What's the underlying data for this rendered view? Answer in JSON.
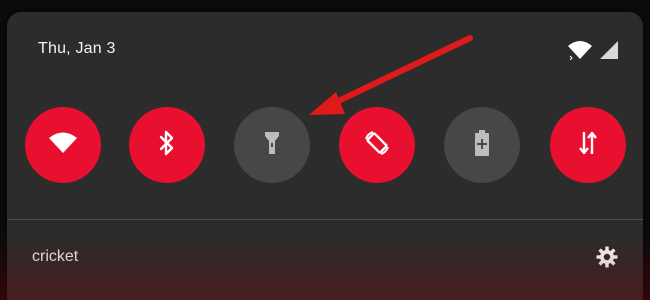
{
  "status_bar": {
    "date": "Thu, Jan 3",
    "icons": [
      "wifi-signal-icon",
      "cell-signal-icon"
    ]
  },
  "quick_settings": {
    "tiles": [
      {
        "name": "wifi",
        "icon": "wifi-icon",
        "active": true
      },
      {
        "name": "bluetooth",
        "icon": "bluetooth-icon",
        "active": true
      },
      {
        "name": "flashlight",
        "icon": "flashlight-icon",
        "active": false
      },
      {
        "name": "auto-rotate",
        "icon": "rotate-icon",
        "active": true
      },
      {
        "name": "battery-saver",
        "icon": "battery-saver-icon",
        "active": false
      },
      {
        "name": "mobile-data",
        "icon": "data-transfer-icon",
        "active": true
      }
    ]
  },
  "footer": {
    "carrier": "cricket",
    "settings_icon": "gear-icon"
  },
  "annotation": {
    "type": "arrow",
    "color": "#e01a1a",
    "points_to": "flashlight"
  },
  "colors": {
    "accent": "#e8102e",
    "panel": "#2c2c2c",
    "tile_off": "#474747",
    "text": "#f2f2f2"
  }
}
